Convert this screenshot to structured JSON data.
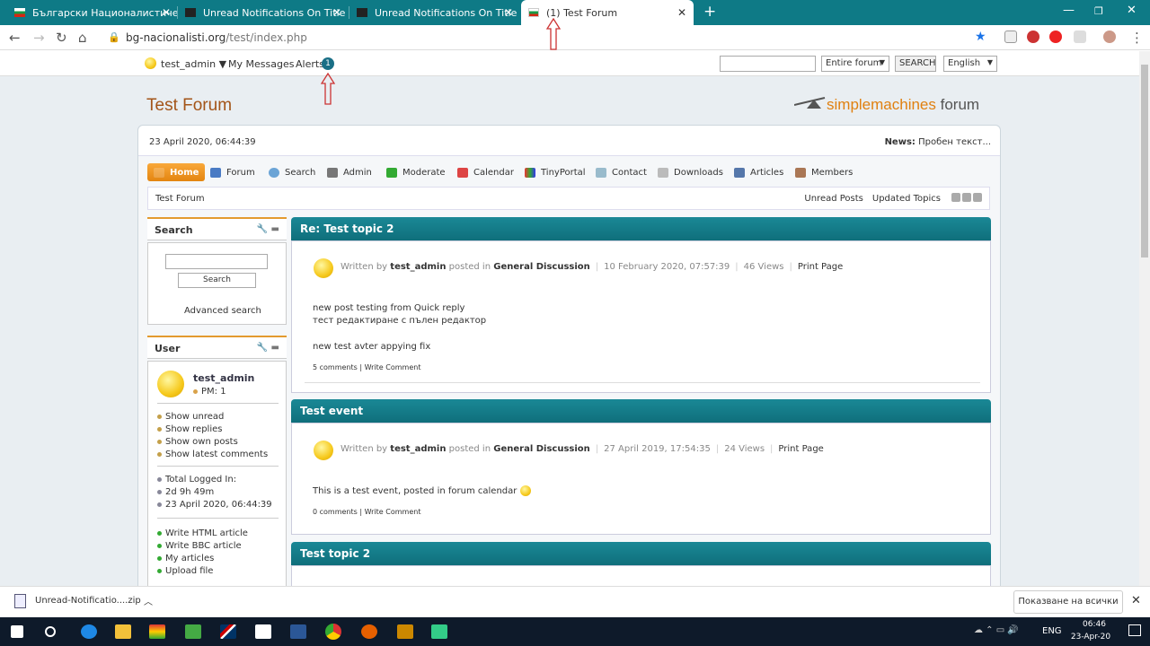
{
  "browser": {
    "tabs": [
      {
        "label": "Български Националистически"
      },
      {
        "label": "Unread Notifications On Title"
      },
      {
        "label": "Unread Notifications On Title"
      },
      {
        "label": "(1) Test Forum"
      }
    ],
    "new_tab": "+",
    "url_host": "bg-nacionalisti.org",
    "url_path": "/test/index.php"
  },
  "topbar": {
    "user": "test_admin",
    "my_messages": "My Messages",
    "alerts": "Alerts",
    "alerts_count": "1",
    "search_scope": "Entire forum",
    "search_button": "SEARCH",
    "language": "English"
  },
  "header": {
    "forum_title": "Test Forum",
    "logo_a": "simplemachines",
    "logo_b": "forum"
  },
  "infobar": {
    "date": "23 April 2020, 06:44:39",
    "news_label": "News:",
    "news_text": "Пробен текст..."
  },
  "menu": [
    {
      "label": "Home",
      "icon": "home-icon"
    },
    {
      "label": "Forum",
      "icon": "forum-icon"
    },
    {
      "label": "Search",
      "icon": "search-icon"
    },
    {
      "label": "Admin",
      "icon": "admin-icon"
    },
    {
      "label": "Moderate",
      "icon": "moderate-icon"
    },
    {
      "label": "Calendar",
      "icon": "calendar-icon"
    },
    {
      "label": "TinyPortal",
      "icon": "tinyportal-icon"
    },
    {
      "label": "Contact",
      "icon": "contact-icon"
    },
    {
      "label": "Downloads",
      "icon": "downloads-icon"
    },
    {
      "label": "Articles",
      "icon": "articles-icon"
    },
    {
      "label": "Members",
      "icon": "members-icon"
    }
  ],
  "breadcrumb": {
    "home": "Test Forum",
    "unread": "Unread Posts",
    "updated": "Updated Topics"
  },
  "sidebar": {
    "search_title": "Search",
    "search_button": "Search",
    "advanced": "Advanced search",
    "user_title": "User",
    "username": "test_admin",
    "pm": "PM: 1",
    "links1": [
      "Show unread",
      "Show replies",
      "Show own posts",
      "Show latest comments"
    ],
    "stats": [
      "Total Logged In:",
      "2d 9h 49m",
      "23 April 2020, 06:44:39"
    ],
    "links2": [
      "Write HTML article",
      "Write BBC article",
      "My articles",
      "Upload file"
    ]
  },
  "posts": [
    {
      "title": "Re: Test topic 2",
      "written_by": "Written by",
      "author": "test_admin",
      "posted_in": "posted in",
      "board": "General Discussion",
      "date": "10 February 2020, 07:57:39",
      "views": "46 Views",
      "print": "Print Page",
      "lines": [
        "new post testing from Quick reply",
        "тест редактиране с пълен редактор",
        "",
        "new test avter appying fix"
      ],
      "comments": "5 comments",
      "write_comment": "| Write Comment"
    },
    {
      "title": "Test event",
      "written_by": "Written by",
      "author": "test_admin",
      "posted_in": "posted in",
      "board": "General Discussion",
      "date": "27 April 2019, 17:54:35",
      "views": "24 Views",
      "print": "Print Page",
      "lines": [
        "This is a test event, posted in forum calendar"
      ],
      "comments": "0 comments",
      "write_comment": "| Write Comment"
    },
    {
      "title": "Test topic 2"
    }
  ],
  "download": {
    "file": "Unread-Notificatio....zip",
    "show_all": "Показване на всички"
  },
  "taskbar": {
    "lang": "ENG",
    "time": "06:46",
    "date": "23-Apr-20"
  },
  "colors": {
    "accent": "#0e7a86",
    "title": "#a35418",
    "home": "#f09a22"
  }
}
